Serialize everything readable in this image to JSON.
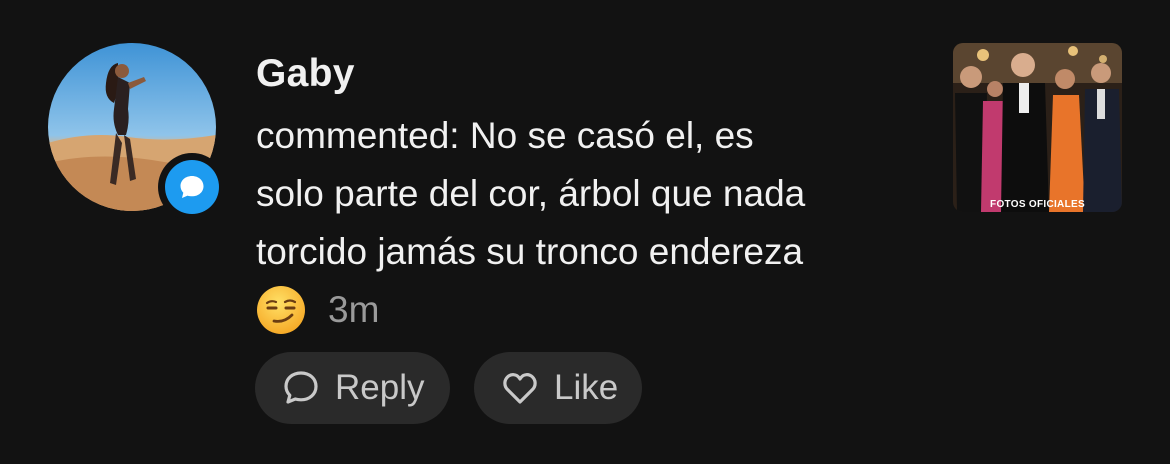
{
  "notification": {
    "username": "Gaby",
    "comment_lines": [
      "commented: No se casó el, es",
      "solo parte del cor, árbol que nada",
      "torcido jamás su tronco endereza"
    ],
    "emoji": "😏",
    "time": "3m",
    "badge_icon": "chat-bubble-icon",
    "accent_color": "#1d9bf0"
  },
  "actions": {
    "reply_label": "Reply",
    "reply_icon": "chat-bubble-outline-icon",
    "like_label": "Like",
    "like_icon": "heart-outline-icon"
  },
  "post_thumbnail": {
    "caption": "FOTOS OFICIALES"
  }
}
